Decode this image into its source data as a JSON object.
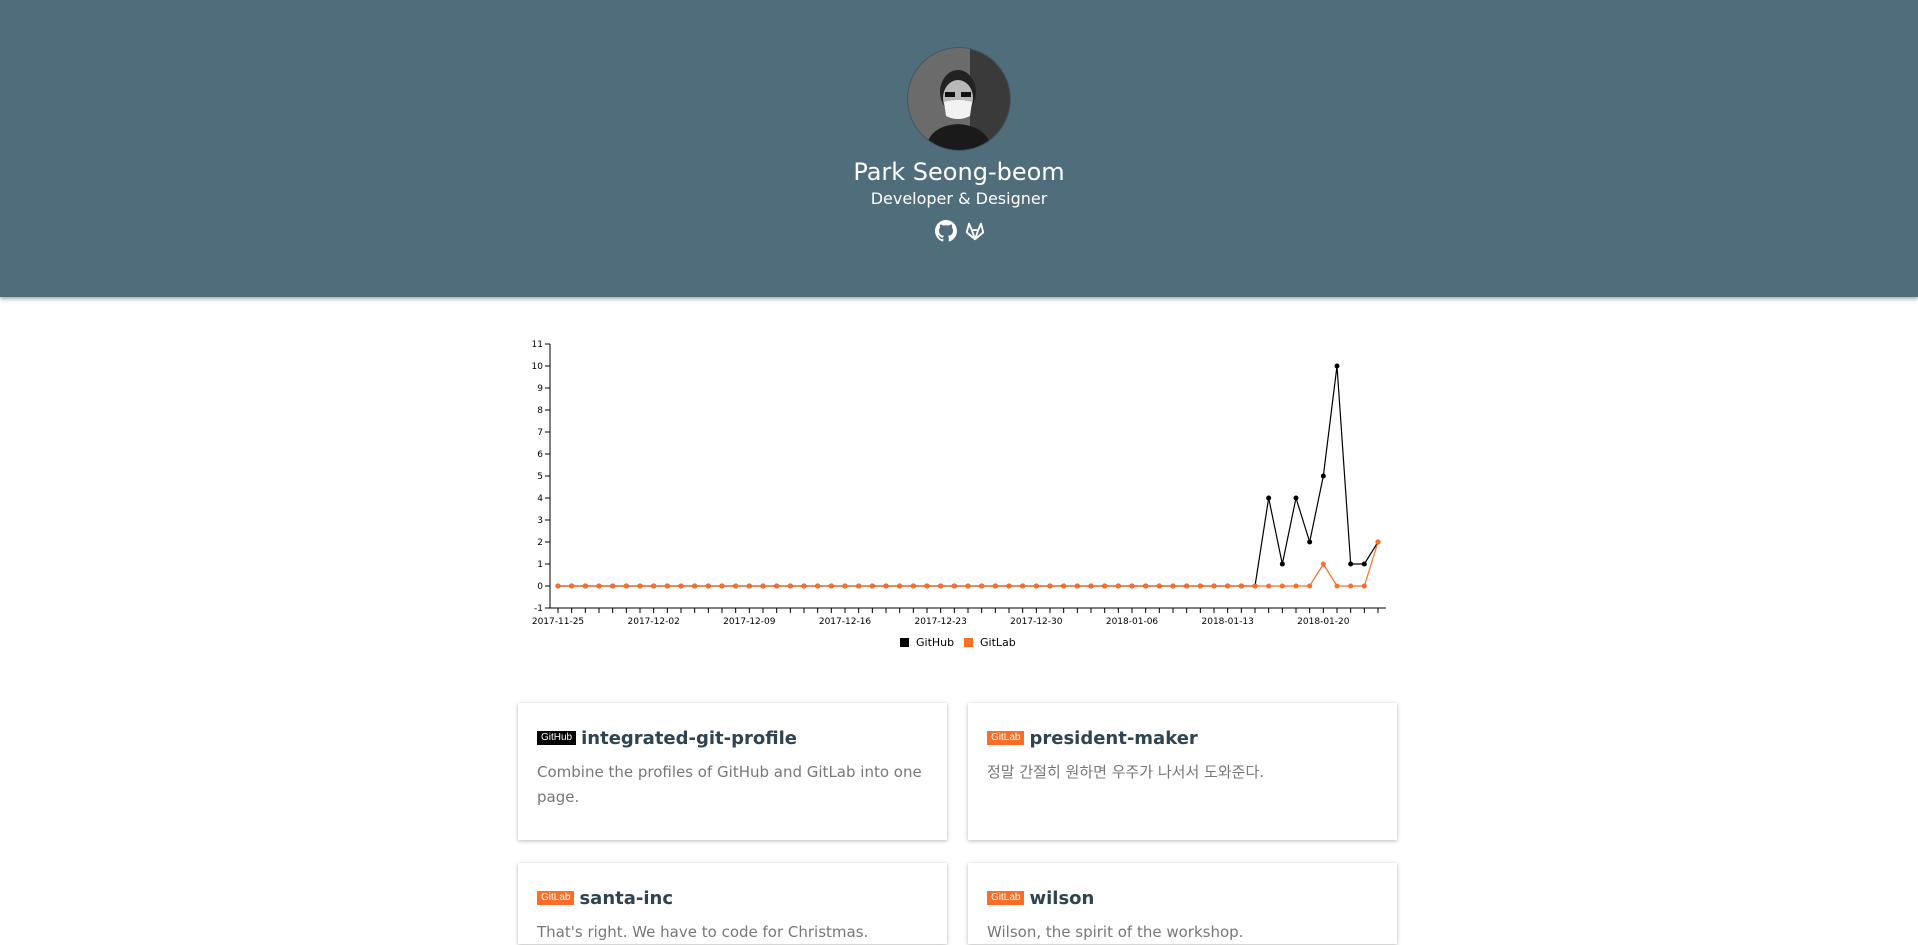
{
  "profile": {
    "name": "Park Seong-beom",
    "subtitle": "Developer & Designer",
    "links": [
      {
        "icon": "github-icon",
        "label": "GitHub"
      },
      {
        "icon": "gitlab-icon",
        "label": "GitLab"
      }
    ]
  },
  "colors": {
    "header_bg": "#4f6d7a",
    "github": "#000000",
    "gitlab": "#fc6d26"
  },
  "chart_data": {
    "type": "line",
    "x_start": "2017-11-25",
    "x_end": "2018-01-24",
    "x_tick_labels": [
      "2017-11-25",
      "2017-12-02",
      "2017-12-09",
      "2017-12-16",
      "2017-12-23",
      "2017-12-30",
      "2018-01-06",
      "2018-01-13",
      "2018-01-20"
    ],
    "y_ticks": [
      -1,
      0,
      1,
      2,
      3,
      4,
      5,
      6,
      7,
      8,
      9,
      10,
      11
    ],
    "ylim": [
      -1,
      11
    ],
    "series": [
      {
        "name": "GitHub",
        "color": "#000000",
        "values": [
          0,
          0,
          0,
          0,
          0,
          0,
          0,
          0,
          0,
          0,
          0,
          0,
          0,
          0,
          0,
          0,
          0,
          0,
          0,
          0,
          0,
          0,
          0,
          0,
          0,
          0,
          0,
          0,
          0,
          0,
          0,
          0,
          0,
          0,
          0,
          0,
          0,
          0,
          0,
          0,
          0,
          0,
          0,
          0,
          0,
          0,
          0,
          0,
          0,
          0,
          0,
          0,
          4,
          1,
          4,
          2,
          5,
          10,
          1,
          1,
          2
        ]
      },
      {
        "name": "GitLab",
        "color": "#fc6d26",
        "values": [
          0,
          0,
          0,
          0,
          0,
          0,
          0,
          0,
          0,
          0,
          0,
          0,
          0,
          0,
          0,
          0,
          0,
          0,
          0,
          0,
          0,
          0,
          0,
          0,
          0,
          0,
          0,
          0,
          0,
          0,
          0,
          0,
          0,
          0,
          0,
          0,
          0,
          0,
          0,
          0,
          0,
          0,
          0,
          0,
          0,
          0,
          0,
          0,
          0,
          0,
          0,
          0,
          0,
          0,
          0,
          0,
          1,
          0,
          0,
          0,
          2
        ]
      }
    ],
    "legend": [
      "GitHub",
      "GitLab"
    ],
    "legend_position": "bottom-center"
  },
  "repos": [
    {
      "source": "GitHub",
      "name": "integrated-git-profile",
      "description": "Combine the profiles of GitHub and GitLab into one page."
    },
    {
      "source": "GitLab",
      "name": "president-maker",
      "description": "정말 간절히 원하면 우주가 나서서 도와준다."
    },
    {
      "source": "GitLab",
      "name": "santa-inc",
      "description": "That's right. We have to code for Christmas."
    },
    {
      "source": "GitLab",
      "name": "wilson",
      "description": "Wilson, the spirit of the workshop."
    }
  ]
}
